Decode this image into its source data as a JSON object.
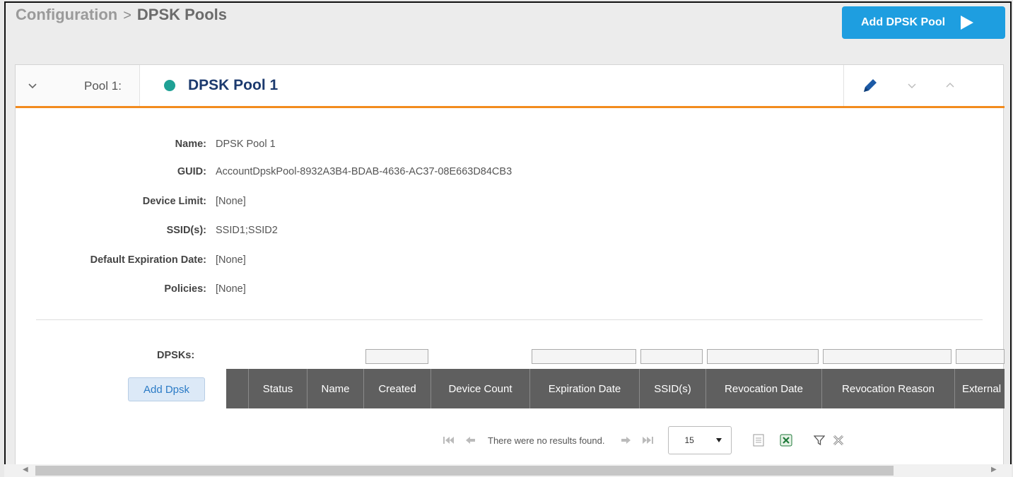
{
  "breadcrumb": {
    "section": "Configuration",
    "separator": ">",
    "current": "DPSK Pools"
  },
  "add_pool_button": "Add DPSK Pool",
  "pool": {
    "prefix": "Pool 1:",
    "title": "DPSK Pool 1",
    "status_color": "#1fa195",
    "details": [
      {
        "label": "Name:",
        "value": "DPSK Pool 1"
      },
      {
        "label": "GUID:",
        "value": "AccountDpskPool-8932A3B4-BDAB-4636-AC37-08E663D84CB3"
      },
      {
        "label": "Device Limit:",
        "value": "[None]"
      },
      {
        "label": "SSID(s):",
        "value": "SSID1;SSID2"
      },
      {
        "label": "Default Expiration Date:",
        "value": "[None]"
      },
      {
        "label": "Policies:",
        "value": "[None]"
      }
    ]
  },
  "dpsks": {
    "label": "DPSKs:",
    "add_button": "Add Dpsk",
    "columns": [
      "Status",
      "Name",
      "Created",
      "Device Count",
      "Expiration Date",
      "SSID(s)",
      "Revocation Date",
      "Revocation Reason",
      "External"
    ],
    "empty_message": "There were no results found.",
    "page_size": "15"
  },
  "colors": {
    "accent": "#1e9ee0",
    "header_border": "#f28b1e",
    "title": "#1c3a6e",
    "grid_header": "#5f5f5f"
  },
  "icons": [
    "chevron-down-icon",
    "edit-icon",
    "chevron-up-icon",
    "first-page-icon",
    "prev-page-icon",
    "next-page-icon",
    "last-page-icon",
    "export-icon",
    "excel-icon",
    "filter-icon",
    "clear-filter-icon"
  ]
}
